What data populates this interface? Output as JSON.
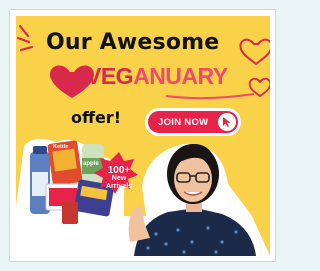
{
  "theme": {
    "banner_bg": "#f9d24a",
    "brand_red": "#d8284c",
    "button_red": "#e8234a",
    "heart_red": "#d8284c"
  },
  "banner": {
    "headline": "Our Awesome",
    "brand_prefix": "VEG",
    "brand_suffix": "ANUARY",
    "offer_text": "offer!",
    "join_button_label": "JOIN NOW",
    "cursor_icon": "pointer-cursor-icon",
    "badge_line1": "100+",
    "badge_line2": "New",
    "badge_line3": "Arrivals"
  },
  "products": {
    "can_label": "apple",
    "bag_label": "Kettle"
  }
}
